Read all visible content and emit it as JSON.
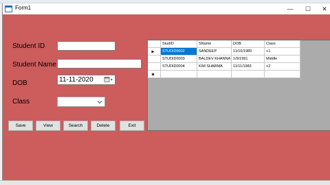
{
  "window": {
    "title": "Form1",
    "minimize_glyph": "—",
    "maximize_glyph": "☐",
    "close_glyph": "✕"
  },
  "form": {
    "student_id_label": "Student ID",
    "student_name_label": "Student Name",
    "dob_label": "DOB",
    "class_label": "Class",
    "student_id_value": "",
    "student_name_value": "",
    "dob_value": "11-11-2020",
    "class_value": ""
  },
  "buttons": {
    "save": "Save",
    "view": "View",
    "search": "Search",
    "delete": "Delete",
    "exit": "Exit"
  },
  "grid": {
    "columns": [
      "StudID",
      "SName",
      "DOB",
      "Class"
    ],
    "rows": [
      [
        "STUDID0002",
        "SANDEEP",
        "11/10/1989",
        "+1"
      ],
      [
        "STUDID0003",
        "BALDEV KHANNA",
        "1/9/1991",
        "Middle"
      ],
      [
        "STUDID0004",
        "KIM SHARMA",
        "11/11/1983",
        "+2"
      ]
    ],
    "current_row_marker": "right-triangle-icon",
    "new_row_marker": "asterisk-icon"
  },
  "colors": {
    "form_background": "#cd5c5c",
    "grid_background": "#ababab",
    "selection": "#0078d7"
  }
}
